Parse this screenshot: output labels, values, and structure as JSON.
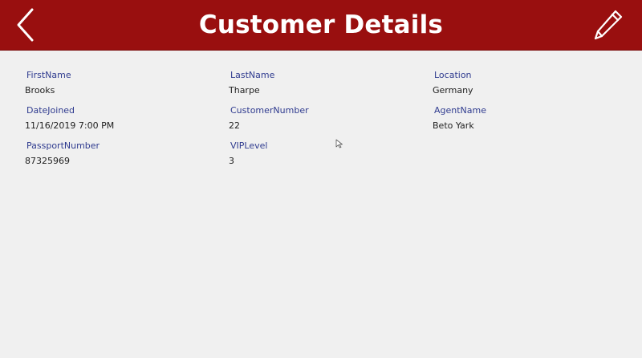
{
  "header": {
    "title": "Customer Details",
    "back_icon": "chevron-left-icon",
    "edit_icon": "pencil-icon",
    "background_color": "#990f0f",
    "text_color": "#ffffff"
  },
  "form": {
    "label_color": "#2f3b8f",
    "fields": [
      {
        "label": "FirstName",
        "value": "Brooks"
      },
      {
        "label": "LastName",
        "value": "Tharpe"
      },
      {
        "label": "Location",
        "value": "Germany"
      },
      {
        "label": "DateJoined",
        "value": "11/16/2019 7:00 PM"
      },
      {
        "label": "CustomerNumber",
        "value": "22"
      },
      {
        "label": "AgentName",
        "value": "Beto Yark"
      },
      {
        "label": "PassportNumber",
        "value": "87325969"
      },
      {
        "label": "VIPLevel",
        "value": "3"
      }
    ]
  }
}
